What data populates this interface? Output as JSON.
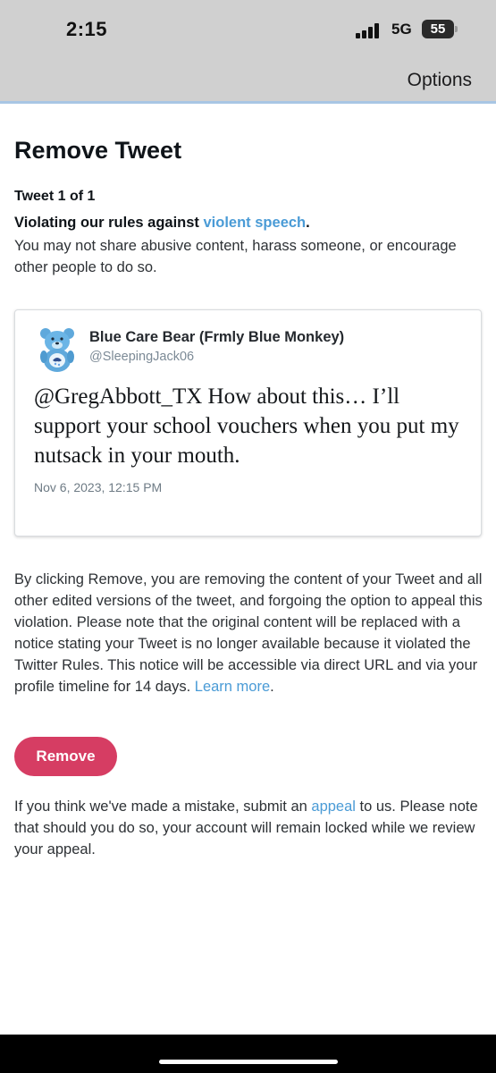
{
  "status_bar": {
    "time": "2:15",
    "network": "5G",
    "battery": "55"
  },
  "nav": {
    "options_label": "Options"
  },
  "page": {
    "title": "Remove Tweet",
    "counter": "Tweet 1 of 1",
    "rule_prefix": "Violating our rules against ",
    "rule_link": "violent speech",
    "rule_suffix": ".",
    "rule_description": "You may not share abusive content, harass someone, or encourage other people to do so."
  },
  "tweet": {
    "display_name": "Blue Care Bear (Frmly Blue Monkey)",
    "handle": "@SleepingJack06",
    "text": "@GregAbbott_TX How about this… I’ll support your school vouchers when you put my nutsack in your mouth.",
    "timestamp": "Nov 6, 2023, 12:15 PM",
    "avatar_icon": "care-bear-avatar-icon"
  },
  "notice": {
    "body": "By clicking Remove, you are removing the content of your Tweet and all other edited versions of the tweet, and forgoing the option to appeal this violation. Please note that the original content will be replaced with a notice stating your Tweet is no longer available because it violated the Twitter Rules. This notice will be accessible via direct URL and via your profile timeline for 14 days. ",
    "learn_more": "Learn more",
    "end": "."
  },
  "actions": {
    "remove_label": "Remove"
  },
  "appeal": {
    "prefix": "If you think we've made a mistake, submit an ",
    "link": "appeal",
    "suffix": " to us. Please note that should you do so, your account will remain locked while we review your appeal."
  },
  "colors": {
    "link": "#4a9bd6",
    "remove_button": "#d63d63",
    "header_bg": "#d0d0d0",
    "header_border": "#a8c6e4"
  }
}
